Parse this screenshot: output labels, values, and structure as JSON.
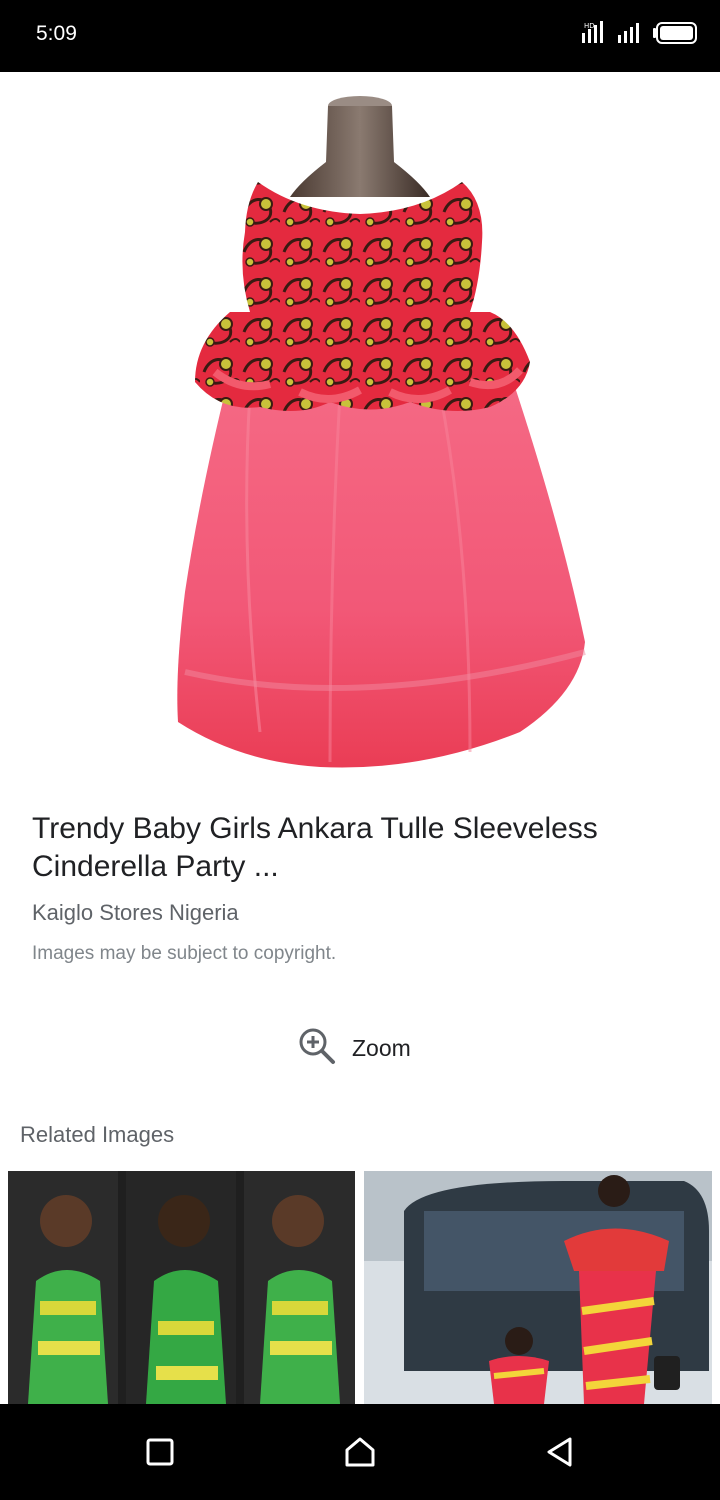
{
  "status_bar": {
    "time": "5:09",
    "icons": [
      "signal-hd-icon",
      "signal-icon",
      "battery-icon"
    ]
  },
  "main_image": {
    "alt": "Trendy Baby Girls Ankara Tulle Sleeveless Cinderella Party ..."
  },
  "result": {
    "title": "Trendy Baby Girls Ankara Tulle Sleeveless Cinderella Party ...",
    "source": "Kaiglo Stores Nigeria",
    "copyright_note": "Images may be subject to copyright."
  },
  "zoom": {
    "label": "Zoom",
    "icon": "zoom-in-icon"
  },
  "related": {
    "heading": "Related Images"
  },
  "nav_bar": {
    "buttons": [
      "recents-square-icon",
      "home-icon",
      "back-triangle-icon"
    ]
  },
  "colors": {
    "status_bar": "#000000",
    "text_primary": "#202124",
    "text_secondary": "#5f6368",
    "text_muted": "#80868b",
    "dress_pink": "#f0506e",
    "dress_red": "#e2273d",
    "ankara_yellow": "#c8c23a"
  }
}
